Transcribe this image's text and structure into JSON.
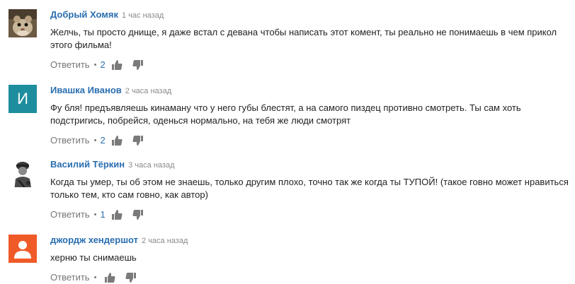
{
  "comments": [
    {
      "author": "Добрый Хомяк",
      "time": "1 час назад",
      "text": "Желчь, ты просто днище, я даже встал с девана чтобы написать этот комент, ты реально не понимаешь в чем прикол этого фильма!",
      "reply_label": "Ответить",
      "likes": "2",
      "avatar": "hamster-photo"
    },
    {
      "author": "Ивашка Иванов",
      "time": "2 часа назад",
      "text": "Фу бля! предъявляешь кинаману  что у него губы блестят, а на самого пиздец противно смотреть. Ты сам хоть подстригись, побрейся, оденься нормально, на тебя же люди смотрят",
      "reply_label": "Ответить",
      "likes": "2",
      "avatar_letter": "И",
      "avatar_color": "#1e8e9e"
    },
    {
      "author": "Василий Тёркин",
      "time": "3 часа назад",
      "text": "Когда ты умер, ты об этом не знаешь, только другим плохо, точно так же когда ты ТУПОЙ! (такое говно может нравиться только тем, кто сам говно, как автор)",
      "reply_label": "Ответить",
      "likes": "1",
      "avatar": "soldier-sketch"
    },
    {
      "author": "джордж хендершот",
      "time": "2 часа назад",
      "text": "херню ты снимаешь",
      "reply_label": "Ответить",
      "likes": "",
      "avatar": "default-user",
      "avatar_color": "#f05a28"
    }
  ],
  "colors": {
    "author": "#2a6eb0",
    "time": "#8a8a8a",
    "action": "#767676",
    "thumb": "#7a7a7a"
  },
  "icons": [
    "thumb-up-icon",
    "thumb-down-icon",
    "default-user-icon"
  ]
}
